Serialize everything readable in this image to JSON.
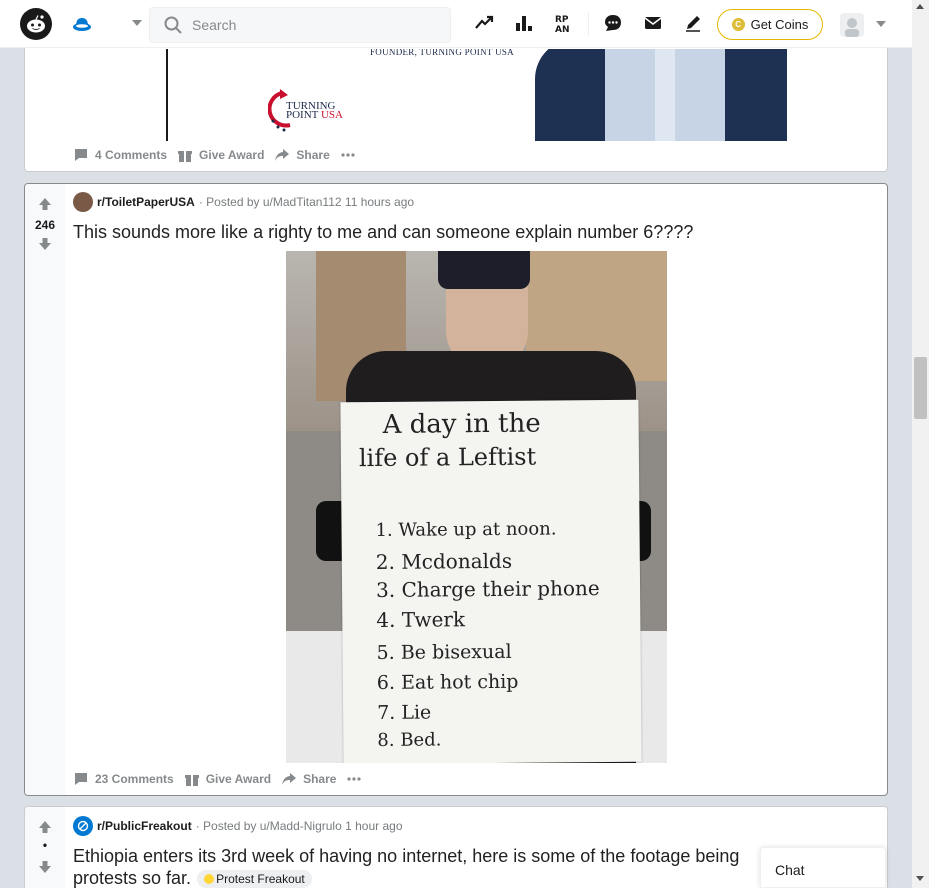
{
  "header": {
    "search_placeholder": "Search",
    "get_coins_label": "Get Coins",
    "icons": [
      "reddit-logo",
      "home-icon",
      "trending-icon",
      "leaderboard-icon",
      "rpan-icon",
      "chat-icon",
      "mail-icon",
      "pen-icon"
    ]
  },
  "posts": [
    {
      "image_caption_top": "FOUNDER, TURNING POINT USA",
      "image_logo_line1": "TURNING",
      "image_logo_line2": "POINT",
      "image_logo_line3": "USA",
      "comments_label": "4 Comments",
      "award_label": "Give Award",
      "share_label": "Share"
    },
    {
      "score": "246",
      "subreddit": "r/ToiletPaperUSA",
      "posted_by": "· Posted by u/MadTitan112",
      "time": "11 hours ago",
      "title": "This sounds more like a righty to me and can someone explain number 6????",
      "sign": {
        "line1": "A day in the",
        "line2": "life of a Leftist",
        "items": [
          "1. Wake up at noon.",
          "2. Mcdonalds",
          "3. Charge their phone",
          "4. Twerk",
          "5. Be bisexual",
          "6. Eat hot chip",
          "7. Lie",
          "8. Bed."
        ]
      },
      "comments_label": "23 Comments",
      "award_label": "Give Award",
      "share_label": "Share"
    },
    {
      "score": "•",
      "subreddit": "r/PublicFreakout",
      "posted_by": "· Posted by u/Madd-Nigrulo",
      "time": "1 hour ago",
      "title": "Ethiopia enters its 3rd week of having no internet, here is some of the footage being",
      "title_line2": "protests so far.",
      "flair": "Protest Freakout"
    }
  ],
  "chat": {
    "label": "Chat"
  },
  "colors": {
    "accent": "#0079d3",
    "coins_border": "#e5b800",
    "bg": "#dae0e6"
  }
}
